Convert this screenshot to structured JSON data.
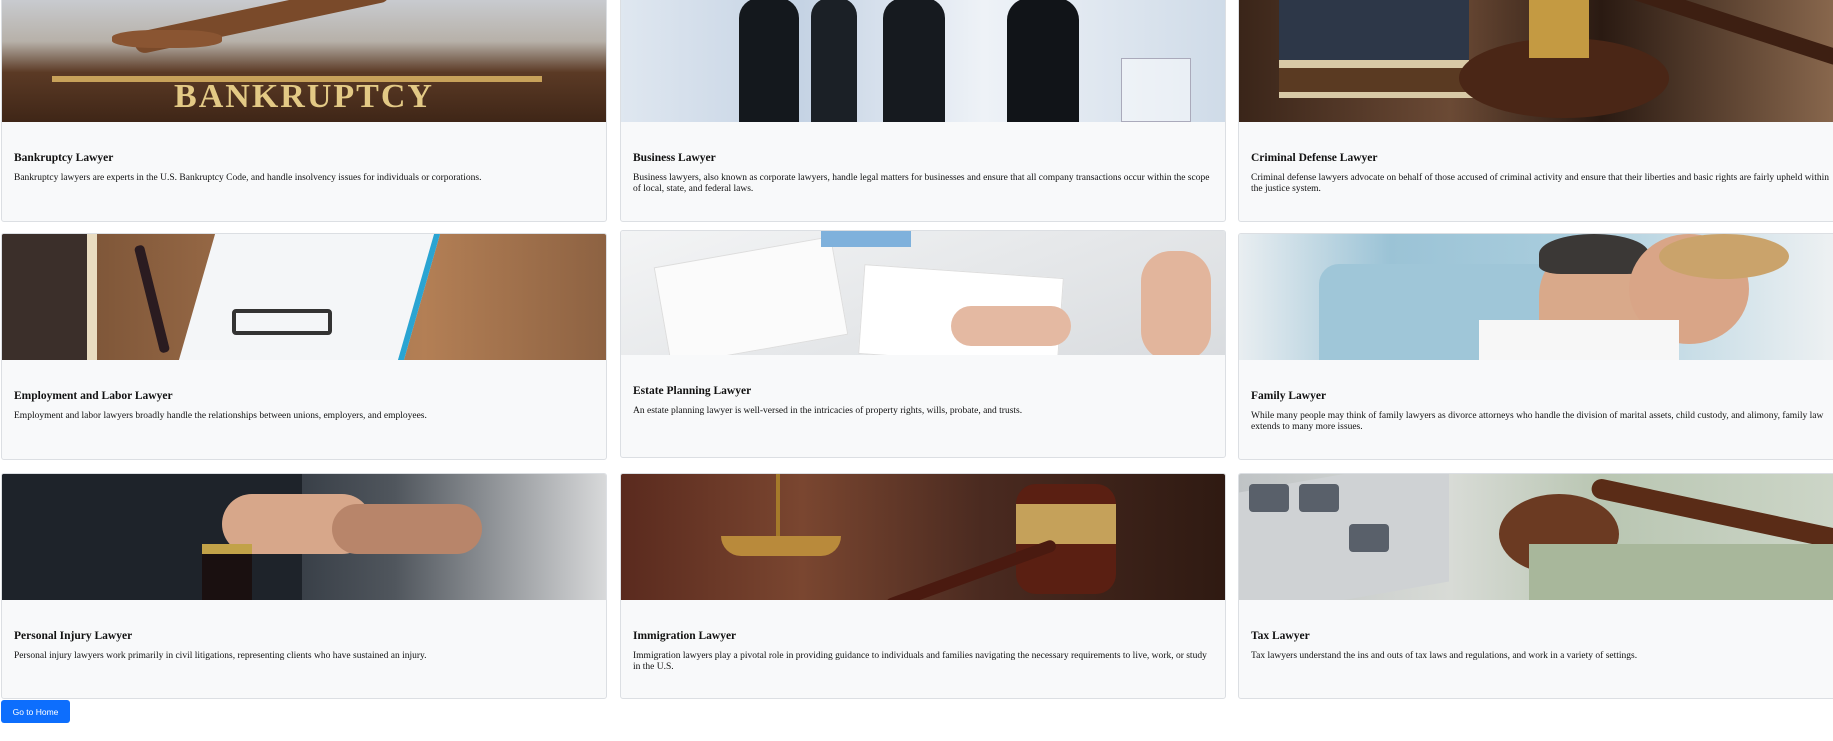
{
  "cards": [
    {
      "title": "Bankruptcy Lawyer",
      "text": "Bankruptcy lawyers are experts in the U.S. Bankruptcy Code, and handle insolvency issues for individuals or corporations.",
      "image_text": "BANKRUPTCY"
    },
    {
      "title": "Business Lawyer",
      "text": "Business lawyers, also known as corporate lawyers, handle legal matters for businesses and ensure that all company transactions occur within the scope of local, state, and federal laws."
    },
    {
      "title": "Criminal Defense Lawyer",
      "text": "Criminal defense lawyers advocate on behalf of those accused of criminal activity and ensure that their liberties and basic rights are fairly upheld within the justice system."
    },
    {
      "title": "Employment and Labor Lawyer",
      "text": "Employment and labor lawyers broadly handle the relationships between unions, employers, and employees."
    },
    {
      "title": "Estate Planning Lawyer",
      "text": "An estate planning lawyer is well-versed in the intricacies of property rights, wills, probate, and trusts."
    },
    {
      "title": "Family Lawyer",
      "text": "While many people may think of family lawyers as divorce attorneys who handle the division of marital assets, child custody, and alimony, family law extends to many more issues."
    },
    {
      "title": "Personal Injury Lawyer",
      "text": "Personal injury lawyers work primarily in civil litigations, representing clients who have sustained an injury."
    },
    {
      "title": "Immigration Lawyer",
      "text": "Immigration lawyers play a pivotal role in providing guidance to individuals and families navigating the necessary requirements to live, work, or study in the U.S."
    },
    {
      "title": "Tax Lawyer",
      "text": "Tax lawyers understand the ins and outs of tax laws and regulations, and work in a variety of settings."
    }
  ],
  "home_button": "Go to Home",
  "colors": {
    "button": "#0d6efd",
    "card_bg": "#f8f9fa",
    "card_border": "#dcdfe3"
  }
}
